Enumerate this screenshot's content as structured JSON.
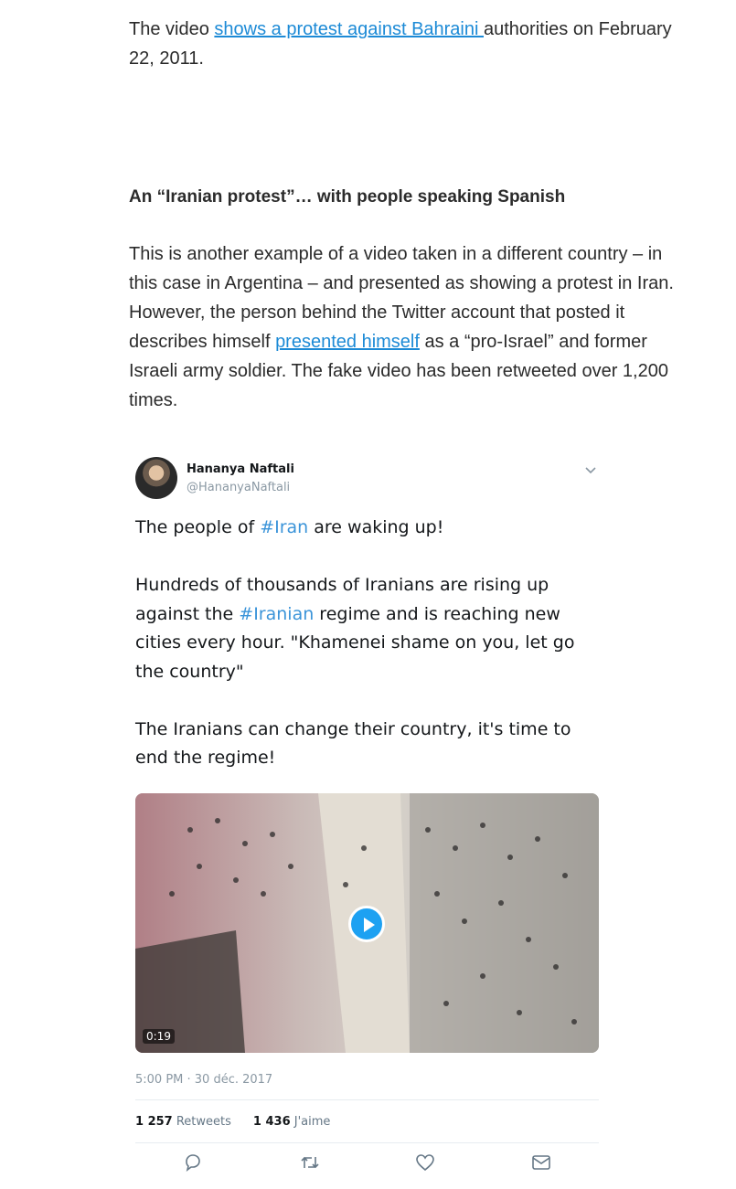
{
  "article": {
    "intro_before_link": "The video ",
    "intro_link": "shows a protest against Bahraini ",
    "intro_after_link": "authorities on February 22, 2011.",
    "heading": "An “Iranian protest”… with people speaking Spanish",
    "para_before_link": "This is another example of a video taken in a different country – in this case in Argentina – and presented as showing a protest in Iran. However, the person behind the Twitter account that posted it describes himself ",
    "para_link": "presented himself",
    "para_after_link": " as a “pro-Israel” and former Israeli army soldier. The fake video has been retweeted over 1,200 times."
  },
  "tweet": {
    "author_name": "Hananya Naftali",
    "author_handle": "@HananyaNaftali",
    "line1_before": "The people of ",
    "line1_tag": "#Iran",
    "line1_after": " are waking up!",
    "para2_before": "Hundreds of thousands of Iranians are rising up against the ",
    "para2_tag": "#Iranian",
    "para2_after": " regime and is reaching new cities every hour. \"Khamenei shame on you, let go the country\"",
    "para3": "The Iranians can change their country, it's time to end the regime!",
    "video_duration": "0:19",
    "timestamp": "5:00 PM · 30 déc. 2017",
    "retweet_count": "1 257",
    "retweet_label": "Retweets",
    "like_count": "1 436",
    "like_label": "J'aime"
  },
  "icons": [
    "chevron-down-icon",
    "reply-icon",
    "retweet-icon",
    "like-icon",
    "dm-icon",
    "play-icon"
  ],
  "colors": {
    "link": "#1c8ad6",
    "hashtag": "#3b94d9",
    "twitter_blue": "#1da1f2",
    "muted": "#8a98a3"
  }
}
